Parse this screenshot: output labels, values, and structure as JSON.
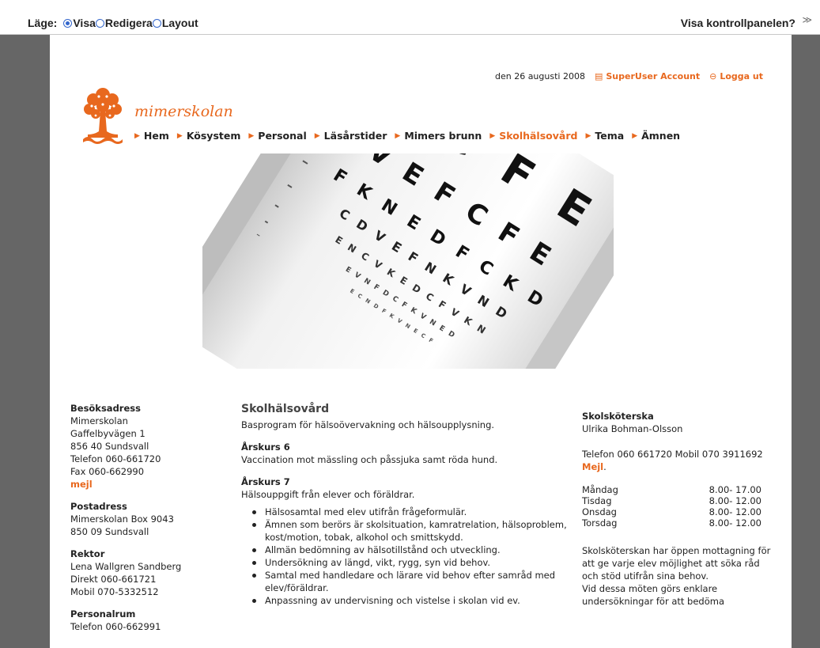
{
  "topbar": {
    "mode_label": "Läge:",
    "modes": [
      {
        "label": "Visa",
        "selected": true
      },
      {
        "label": "Redigera",
        "selected": false
      },
      {
        "label": "Layout",
        "selected": false
      }
    ],
    "control_panel": "Visa kontrollpanelen?",
    "chevron": "≫"
  },
  "header": {
    "date": "den 26 augusti 2008",
    "account": "SuperUser Account",
    "logout": "Logga ut",
    "brand": "mimerskolan"
  },
  "nav": [
    {
      "label": "Hem",
      "active": false
    },
    {
      "label": "Kösystem",
      "active": false
    },
    {
      "label": "Personal",
      "active": false
    },
    {
      "label": "Läsårstider",
      "active": false
    },
    {
      "label": "Mimers brunn",
      "active": false
    },
    {
      "label": "Skolhälsovård",
      "active": true
    },
    {
      "label": "Tema",
      "active": false
    },
    {
      "label": "Ämnen",
      "active": false
    }
  ],
  "hero_chart": {
    "rows": [
      "K C F E",
      "V E F C F E",
      "F K N E D F C K D",
      "C D V E F N K V N D",
      "E N C V K E D C F V K N",
      "E V N F D C F K V N E D",
      "E C N D F K V N E C F"
    ]
  },
  "left": {
    "visit_heading": "Besöksadress",
    "visit_lines": [
      "Mimerskolan",
      "Gaffelbyvägen 1",
      "856 40 Sundsvall",
      "Telefon 060-661720",
      "Fax 060-662990"
    ],
    "visit_mail": "mejl",
    "post_heading": "Postadress",
    "post_lines": [
      "Mimerskolan Box 9043",
      "850 09 Sundsvall"
    ],
    "rektor_heading": "Rektor",
    "rektor_lines": [
      "Lena Wallgren Sandberg",
      "Direkt 060-661721",
      "Mobil 070-5332512"
    ],
    "staff_heading": "Personalrum",
    "staff_lines": [
      "Telefon 060-662991"
    ]
  },
  "main": {
    "title": "Skolhälsovård",
    "intro": "Basprogram för hälsoövervakning och hälsoupplysning.",
    "sec6_title": "Årskurs 6",
    "sec6_text": "Vaccination mot mässling och påssjuka samt röda hund.",
    "sec7_title": "Årskurs 7",
    "sec7_text": "Hälsouppgift från elever och föräldrar.",
    "sec7_items": [
      "Hälsosamtal med elev utifrån frågeformulär.",
      "Ämnen som berörs är skolsituation, kamratrelation, hälsoproblem, kost/motion, tobak, alkohol och smittskydd.",
      "Allmän bedömning av hälsotillstånd och utveckling.",
      "Undersökning av längd, vikt, rygg, syn vid behov.",
      "Samtal med handledare och lärare vid behov efter samråd med elev/föräldrar.",
      "Anpassning av undervisning och vistelse i skolan vid ev."
    ]
  },
  "right": {
    "heading": "Skolsköterska",
    "name": "Ulrika Bohman-Olsson",
    "phone": "Telefon 060 661720 Mobil 070 3911692",
    "mail": "Mejl",
    "mail_suffix": ".",
    "hours": [
      {
        "day": "Måndag",
        "time": "8.00- 17.00"
      },
      {
        "day": "Tisdag",
        "time": "8.00- 12.00"
      },
      {
        "day": "Onsdag",
        "time": "8.00- 12.00"
      },
      {
        "day": "Torsdag",
        "time": "8.00- 12.00"
      }
    ],
    "para1": "Skolsköterskan har öppen mottagning för att ge varje elev möjlighet att söka råd och stöd utifrån sina behov.",
    "para2": "Vid dessa möten görs enklare undersökningar för att bedöma"
  }
}
